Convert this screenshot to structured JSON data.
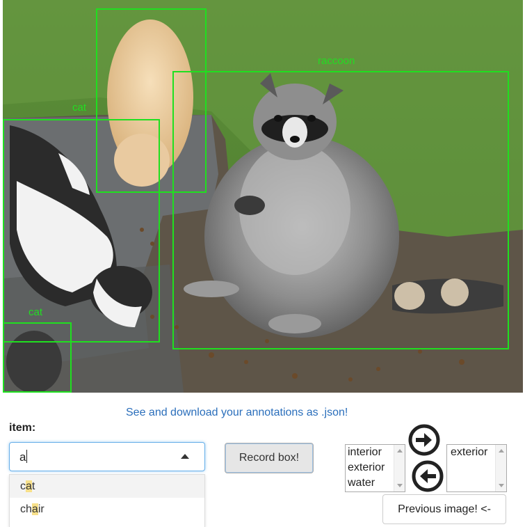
{
  "image": {
    "boxes": [
      {
        "label": "cat"
      },
      {
        "label": "raccoon"
      },
      {
        "label": "cat"
      },
      {
        "label": "cat"
      }
    ]
  },
  "links": {
    "json_download": "See and download your annotations as .json!"
  },
  "item": {
    "label": "item:",
    "value": "a",
    "options": [
      {
        "pre": "c",
        "match": "a",
        "post": "t"
      },
      {
        "pre": "ch",
        "match": "a",
        "post": "ir"
      }
    ]
  },
  "record_button": "Record box!",
  "lists": {
    "available": [
      "interior",
      "exterior",
      "water"
    ],
    "selected": [
      "exterior"
    ]
  },
  "icons": {
    "move_right": "arrow-right-circle-icon",
    "move_left": "arrow-left-circle-icon"
  },
  "previous_button": "Previous image! <-",
  "colors": {
    "bbox": "#1fe01f",
    "link": "#2a6ebb"
  }
}
